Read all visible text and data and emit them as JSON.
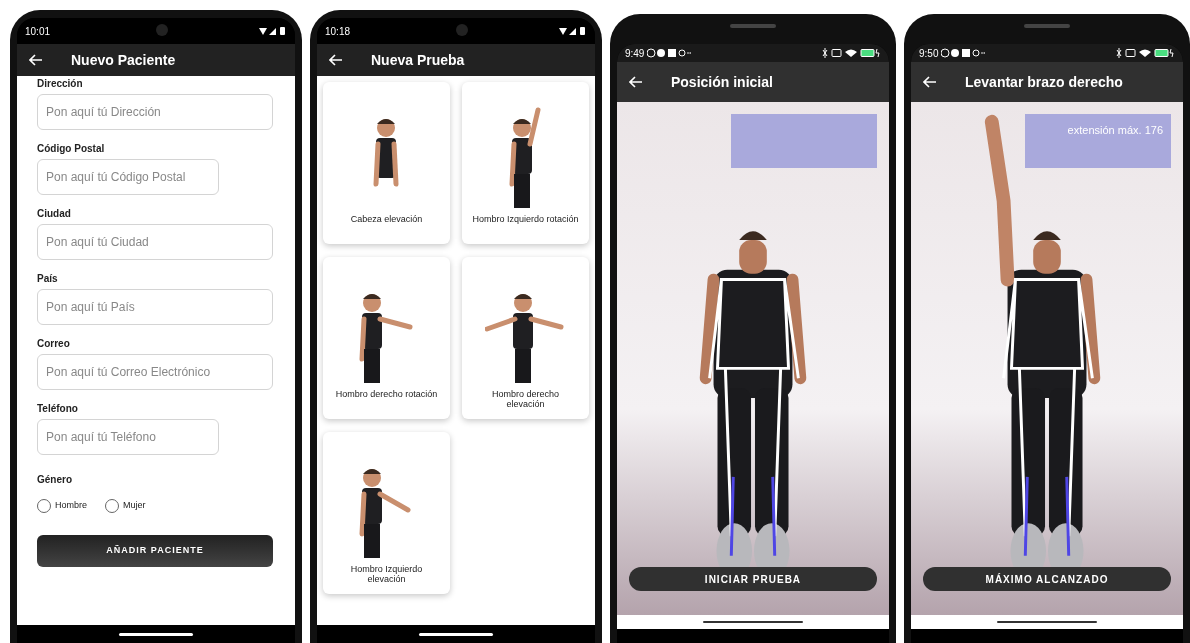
{
  "screens": [
    {
      "kind": "form",
      "time": "10:01",
      "title": "Nuevo Paciente",
      "fields": [
        {
          "label": "Dirección",
          "placeholder": "Pon aquí tú Dirección",
          "wide": true
        },
        {
          "label": "Código Postal",
          "placeholder": "Pon aquí tú Código Postal",
          "wide": false
        },
        {
          "label": "Ciudad",
          "placeholder": "Pon aquí tú Ciudad",
          "wide": true
        },
        {
          "label": "País",
          "placeholder": "Pon aquí tú País",
          "wide": true
        },
        {
          "label": "Correo",
          "placeholder": "Pon aquí tú Correo Electrónico",
          "wide": true
        },
        {
          "label": "Teléfono",
          "placeholder": "Pon aquí tú Teléfono",
          "wide": false
        }
      ],
      "gender": {
        "label": "Género",
        "options": [
          {
            "label": "Hombre",
            "selected": false
          },
          {
            "label": "Mujer",
            "selected": false
          }
        ]
      },
      "button": "AÑADIR PACIENTE"
    },
    {
      "kind": "grid",
      "time": "10:18",
      "title": "Nueva Prueba",
      "tests": [
        {
          "label": "Cabeza elevación"
        },
        {
          "label": "Hombro Izquierdo rotación"
        },
        {
          "label": "Hombro derecho rotación"
        },
        {
          "label": "Hombro derecho elevación"
        },
        {
          "label": "Hombro Izquierdo elevación"
        }
      ]
    },
    {
      "kind": "camera",
      "time": "9:49",
      "title": "Posición inicial",
      "button": "INICIAR PRUEBA"
    },
    {
      "kind": "camera",
      "time": "9:50",
      "title": "Levantar brazo derecho",
      "readout": "extensión máx. 176",
      "button": "MÁXIMO ALCANZADO"
    }
  ]
}
